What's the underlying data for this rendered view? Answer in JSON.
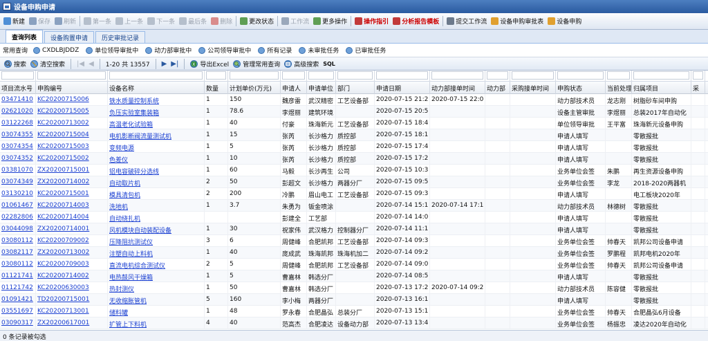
{
  "window": {
    "title": "设备申购申请"
  },
  "toolbar": {
    "items": [
      {
        "label": "新建",
        "icon": "new-doc-icon",
        "enabled": true
      },
      {
        "label": "保存",
        "icon": "save-icon",
        "enabled": false
      },
      {
        "label": "刷新",
        "icon": "refresh-icon",
        "enabled": false
      },
      {
        "label": "第一条",
        "icon": "first-icon",
        "enabled": false
      },
      {
        "label": "上一条",
        "icon": "prev-icon",
        "enabled": false
      },
      {
        "label": "下一条",
        "icon": "next-icon",
        "enabled": false
      },
      {
        "label": "最后条",
        "icon": "last-icon",
        "enabled": false
      },
      {
        "label": "删除",
        "icon": "delete-icon",
        "enabled": false
      },
      {
        "label": "更改状态",
        "icon": "status-icon",
        "enabled": true
      },
      {
        "label": "工作流",
        "icon": "workflow-icon",
        "enabled": false
      },
      {
        "label": "更多操作",
        "icon": "more-icon",
        "enabled": true
      },
      {
        "label": "操作指引",
        "icon": "guide-icon",
        "enabled": true,
        "highlight": true
      },
      {
        "label": "分析报告模板",
        "icon": "report-icon",
        "enabled": true,
        "highlight": true
      },
      {
        "label": "提交工作流",
        "icon": "gear-icon",
        "enabled": true
      },
      {
        "label": "设备申购审批表",
        "icon": "form-icon",
        "enabled": true
      },
      {
        "label": "设备申购",
        "icon": "form-icon",
        "enabled": true
      }
    ]
  },
  "tabs": [
    {
      "label": "查询列表",
      "active": true
    },
    {
      "label": "设备购置申请",
      "active": false
    },
    {
      "label": "历史审批记录",
      "active": false
    }
  ],
  "filters": {
    "label": "常用查询",
    "items": [
      "CXDLBJDDZ",
      "单位领导审批中",
      "动力部审批中",
      "公司领导审批中",
      "所有记录",
      "未审批任务",
      "已审批任务"
    ]
  },
  "pager": {
    "search": "搜索",
    "clear": "清空搜索",
    "range": "1-20 共 13557",
    "export": "导出Excel",
    "manage": "管理常用查询",
    "advanced": "高级搜索",
    "sql": "SQL"
  },
  "columns": [
    "项目流水号",
    "申购编号",
    "设备名称",
    "数量",
    "计划单价(万元)",
    "申请人",
    "申请单位",
    "部门",
    "申请日期",
    "动力部接单时间",
    "动力部",
    "采购接单时间",
    "申购状态",
    "当前处理人",
    "归属项目",
    "采"
  ],
  "rows": [
    [
      "03471410",
      "KC20200715006",
      "铁水质量控制系统",
      "1",
      "150",
      "魏彦雷",
      "武汉精密",
      "工艺设备部",
      "2020-07-15 21:2",
      "2020-07-15 22:0",
      "",
      "",
      "动力部技术员",
      "龙志刚",
      "树脂砂车间申购",
      ""
    ],
    [
      "02621020",
      "KC20200715005",
      "负压实验室集装箱",
      "1",
      "78.6",
      "李煜丽",
      "建筑环境",
      "",
      "2020-07-15 20:5",
      "",
      "",
      "",
      "设备主管审批",
      "李煜丽",
      "总装2017年自动化",
      ""
    ],
    [
      "03122268",
      "KC20200713002",
      "高温老化试验箱",
      "1",
      "40",
      "付豪",
      "珠海新元",
      "工艺设备部",
      "2020-07-15 18:4",
      "",
      "",
      "",
      "单位领导审批",
      "王平富",
      "珠海新元设备申购",
      ""
    ],
    [
      "03074355",
      "KC20200715004",
      "电机影断阀流量测试机",
      "1",
      "15",
      "张芮",
      "长沙格力",
      "质控部",
      "2020-07-15 18:1",
      "",
      "",
      "",
      "申请人填写",
      "",
      "零散报批",
      ""
    ],
    [
      "03074354",
      "KC20200715003",
      "变频电源",
      "1",
      "5",
      "张芮",
      "长沙格力",
      "质控部",
      "2020-07-15 17:4",
      "",
      "",
      "",
      "申请人填写",
      "",
      "零散报批",
      ""
    ],
    [
      "03074352",
      "KC20200715002",
      "色差仪",
      "1",
      "10",
      "张芮",
      "长沙格力",
      "质控部",
      "2020-07-15 17:2",
      "",
      "",
      "",
      "申请人填写",
      "",
      "零散报批",
      ""
    ],
    [
      "03381070",
      "ZX20200715001",
      "铝电容破碎分选线",
      "1",
      "60",
      "马毅",
      "长沙再生",
      "公司",
      "2020-07-15 10:3",
      "",
      "",
      "",
      "业务单位会签",
      "朱鹏",
      "再生资源设备申购",
      ""
    ],
    [
      "03074349",
      "ZX20200714002",
      "自动取片机",
      "2",
      "50",
      "彭超文",
      "长沙格力",
      "两器分厂",
      "2020-07-15 09:5",
      "",
      "",
      "",
      "业务单位会签",
      "李龙",
      "2018-2020两器机",
      ""
    ],
    [
      "03130210",
      "KC20200715001",
      "模具清包机",
      "2",
      "200",
      "冷鹏",
      "眉山电工",
      "工艺设备部",
      "2020-07-15 09:3",
      "",
      "",
      "",
      "申请人填写",
      "",
      "电工板块2020年",
      ""
    ],
    [
      "01061467",
      "KC20200714003",
      "洗地机",
      "1",
      "3.7",
      "朱勇为",
      "钣金喷涂",
      "",
      "2020-07-14 15:1",
      "2020-07-14 17:1",
      "",
      "",
      "动力部技术员",
      "林德树",
      "零散报批",
      ""
    ],
    [
      "02282806",
      "KC20200714004",
      "自动绕扎机",
      "",
      "",
      "彭建全",
      "工艺部",
      "",
      "2020-07-14 14:0",
      "",
      "",
      "",
      "申请人填写",
      "",
      "零散报批",
      ""
    ],
    [
      "03044098",
      "ZX20200714001",
      "风机模块自动装配设备",
      "1",
      "30",
      "祝家伟",
      "武汉格力",
      "控制器分厂",
      "2020-07-14 11:1",
      "",
      "",
      "",
      "申请人填写",
      "",
      "零散报批",
      ""
    ],
    [
      "03080112",
      "KC20200709002",
      "压降阻抗测试仪",
      "3",
      "6",
      "周健峰",
      "合肥凯邦",
      "工艺设备部",
      "2020-07-14 09:3",
      "",
      "",
      "",
      "业务单位会签",
      "帅春天",
      "凯邦公司设备申请",
      ""
    ],
    [
      "03082117",
      "ZX20200713002",
      "注塑自动上料机",
      "1",
      "40",
      "庞成武",
      "珠海凯邦",
      "珠海机加二",
      "2020-07-14 09:2",
      "",
      "",
      "",
      "业务单位会签",
      "罗鹏程",
      "凯邦电机2020年",
      ""
    ],
    [
      "03080112",
      "KC20200709003",
      "直流电机综合测试仪",
      "2",
      "5",
      "周健峰",
      "合肥凯邦",
      "工艺设备部",
      "2020-07-14 09:0",
      "",
      "",
      "",
      "业务单位会签",
      "帅春天",
      "凯邦公司设备申请",
      ""
    ],
    [
      "01121741",
      "KC20200714002",
      "电热鼓风干燥箱",
      "1",
      "5",
      "曹嘉林",
      "韩选分厂",
      "",
      "2020-07-14 08:5",
      "",
      "",
      "",
      "申请人填写",
      "",
      "零散报批",
      ""
    ],
    [
      "01121742",
      "KC20200630003",
      "热封测仪",
      "1",
      "50",
      "曹嘉林",
      "韩选分厂",
      "",
      "2020-07-13 17:2",
      "2020-07-14 09:2",
      "",
      "",
      "动力部技术员",
      "陈容健",
      "零散报批",
      ""
    ],
    [
      "01091421",
      "TD20200715001",
      "无收缩胀管机",
      "5",
      "160",
      "李小梅",
      "两器分厂",
      "",
      "2020-07-13 16:1",
      "",
      "",
      "",
      "申请人填写",
      "",
      "零散报批",
      ""
    ],
    [
      "03551697",
      "KC20200713001",
      "储料罐",
      "1",
      "48",
      "罗永春",
      "合肥晶弘",
      "总装分厂",
      "2020-07-13 15:1",
      "",
      "",
      "",
      "业务单位会签",
      "帅春天",
      "合肥晶弘6月设备",
      ""
    ],
    [
      "03090317",
      "ZX20200617001",
      "扩管上下料机",
      "4",
      "40",
      "范高杰",
      "合肥凌达",
      "设备动力部",
      "2020-07-13 13:4",
      "",
      "",
      "",
      "业务单位会签",
      "杨振忠",
      "凌达2020年自动化",
      ""
    ]
  ],
  "status": {
    "text": "0 条记录被勾选"
  },
  "colors": {
    "link": "#1a3fd1",
    "highlight": "#cc0000",
    "accent": "#2a5aa0"
  }
}
